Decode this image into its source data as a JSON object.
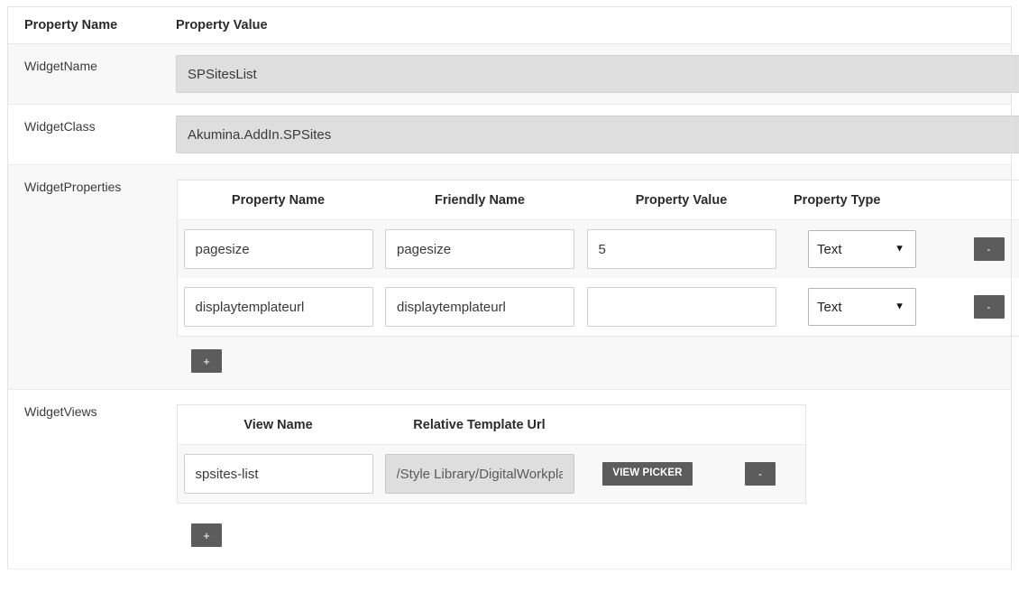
{
  "outer_table": {
    "headers": {
      "property_name": "Property Name",
      "property_value": "Property Value"
    },
    "rows": [
      {
        "label": "WidgetName",
        "value": "SPSitesList",
        "readonly": true
      },
      {
        "label": "WidgetClass",
        "value": "Akumina.AddIn.SPSites",
        "readonly": true
      },
      {
        "label": "WidgetProperties"
      },
      {
        "label": "WidgetViews"
      }
    ]
  },
  "widget_properties": {
    "headers": {
      "property_name": "Property Name",
      "friendly_name": "Friendly Name",
      "property_value": "Property Value",
      "property_type": "Property Type"
    },
    "rows": [
      {
        "property_name": "pagesize",
        "friendly_name": "pagesize",
        "property_value": "5",
        "property_type": "Text",
        "remove_label": "-"
      },
      {
        "property_name": "displaytemplateurl",
        "friendly_name": "displaytemplateurl",
        "property_value": "",
        "property_type": "Text",
        "remove_label": "-"
      }
    ],
    "type_options": [
      "Text"
    ],
    "add_label": "+",
    "value_placeholder": ""
  },
  "widget_views": {
    "headers": {
      "view_name": "View Name",
      "relative_template_url": "Relative Template Url"
    },
    "rows": [
      {
        "view_name": "spsites-list",
        "relative_template_url": "/Style Library/DigitalWorkplace/",
        "view_picker_label": "VIEW PICKER",
        "remove_label": "-"
      }
    ],
    "add_label": "+"
  },
  "colors": {
    "button_dark": "#5c5c5c",
    "readonly_field": "#dedede",
    "row_alt": "#f8f8f8",
    "border": "#e4e4e4",
    "text": "#333333"
  }
}
